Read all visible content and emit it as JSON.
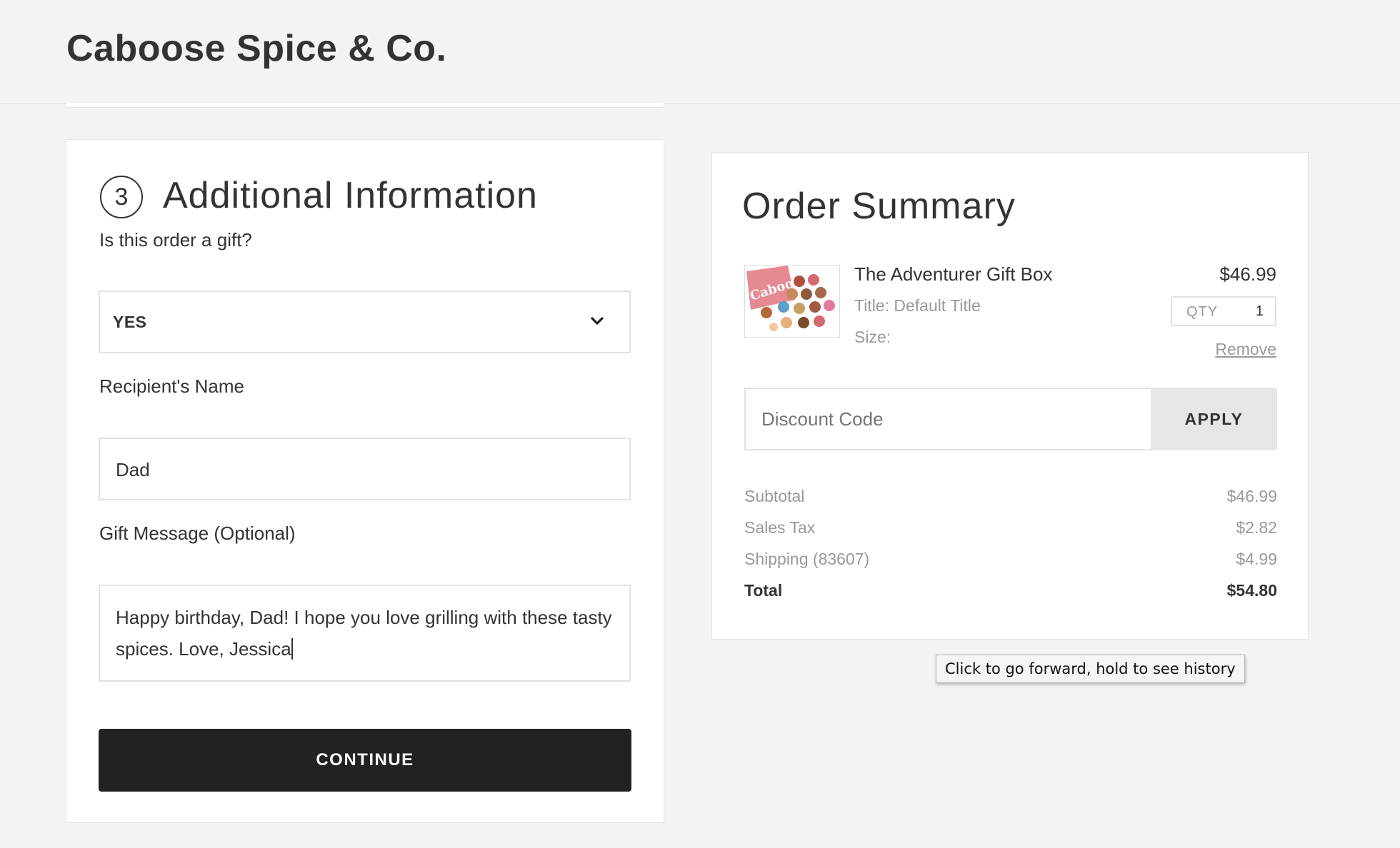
{
  "header": {
    "brand": "Caboose Spice & Co."
  },
  "additional_info": {
    "step_number": "3",
    "title": "Additional Information",
    "gift_question": "Is this order a gift?",
    "gift_selected": "YES",
    "recipient_label": "Recipient's Name",
    "recipient_value": "Dad",
    "message_label": "Gift Message (Optional)",
    "message_value": "Happy birthday, Dad! I hope you love grilling with these tasty spices. Love, Jessica",
    "continue_label": "CONTINUE"
  },
  "order_summary": {
    "title": "Order Summary",
    "item": {
      "name": "The Adventurer Gift Box",
      "price": "$46.99",
      "title_meta": "Title: Default Title",
      "size_meta": "Size:",
      "qty_label": "QTY",
      "qty_value": "1",
      "remove_label": "Remove",
      "thumb_text": "Caboose"
    },
    "discount": {
      "placeholder": "Discount Code",
      "apply_label": "APPLY"
    },
    "rows": [
      {
        "label": "Subtotal",
        "value": "$46.99"
      },
      {
        "label": "Sales Tax",
        "value": "$2.82"
      },
      {
        "label": "Shipping (83607)",
        "value": "$4.99"
      }
    ],
    "total": {
      "label": "Total",
      "value": "$54.80"
    }
  },
  "tooltip": {
    "text": "Click to go forward, hold to see history"
  },
  "colors": {
    "background": "#f3f3f3",
    "card": "#ffffff",
    "text": "#333333",
    "muted": "#999999",
    "primary_button": "#222222",
    "apply_button": "#e6e6e6"
  }
}
